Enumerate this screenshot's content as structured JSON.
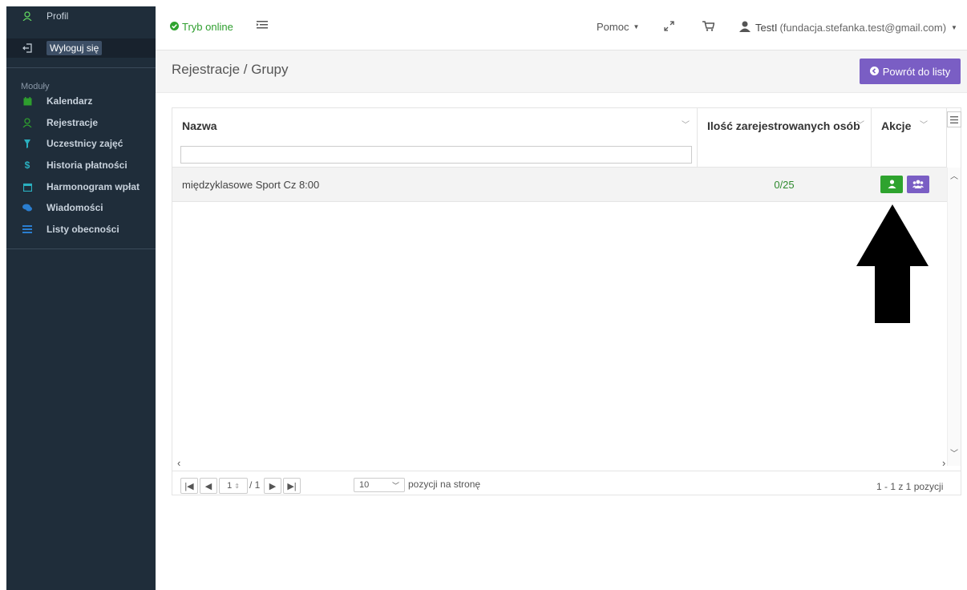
{
  "sidebar": {
    "profile_label": "Profil",
    "logout_label": "Wyloguj się",
    "logout_tooltip": "Wyloguj się",
    "modules_heading": "Moduły",
    "items": [
      {
        "label": "Kalendarz",
        "icon": "calendar-icon"
      },
      {
        "label": "Rejestracje",
        "icon": "user-icon"
      },
      {
        "label": "Uczestnicy zajęć",
        "icon": "pin-icon"
      },
      {
        "label": "Historia płatności",
        "icon": "dollar-icon"
      },
      {
        "label": "Harmonogram wpłat",
        "icon": "calendar-icon"
      },
      {
        "label": "Wiadomości",
        "icon": "chat-icon"
      },
      {
        "label": "Listy obecności",
        "icon": "list-icon"
      }
    ]
  },
  "topbar": {
    "online_label": "Tryb online",
    "help_label": "Pomoc",
    "user_name": "TestI",
    "user_email": "(fundacja.stefanka.test@gmail.com)"
  },
  "page": {
    "breadcrumb": "Rejestracje / Grupy",
    "back_button": "Powrót do listy"
  },
  "table": {
    "columns": [
      "Nazwa",
      "Ilość zarejestrowanych osób",
      "Akcje"
    ],
    "filter_value": "",
    "rows": [
      {
        "name": "międzyklasowe Sport Cz 8:00",
        "count": "0/25"
      }
    ]
  },
  "pager": {
    "current_page": "1",
    "total_pages": "/ 1",
    "page_size": "10",
    "page_size_label": "pozycji na stronę",
    "info": "1 - 1 z 1 pozycji"
  },
  "colors": {
    "sidebar_bg": "#1f2d3a",
    "accent_purple": "#7a5ec4",
    "success_green": "#2ea32e"
  }
}
